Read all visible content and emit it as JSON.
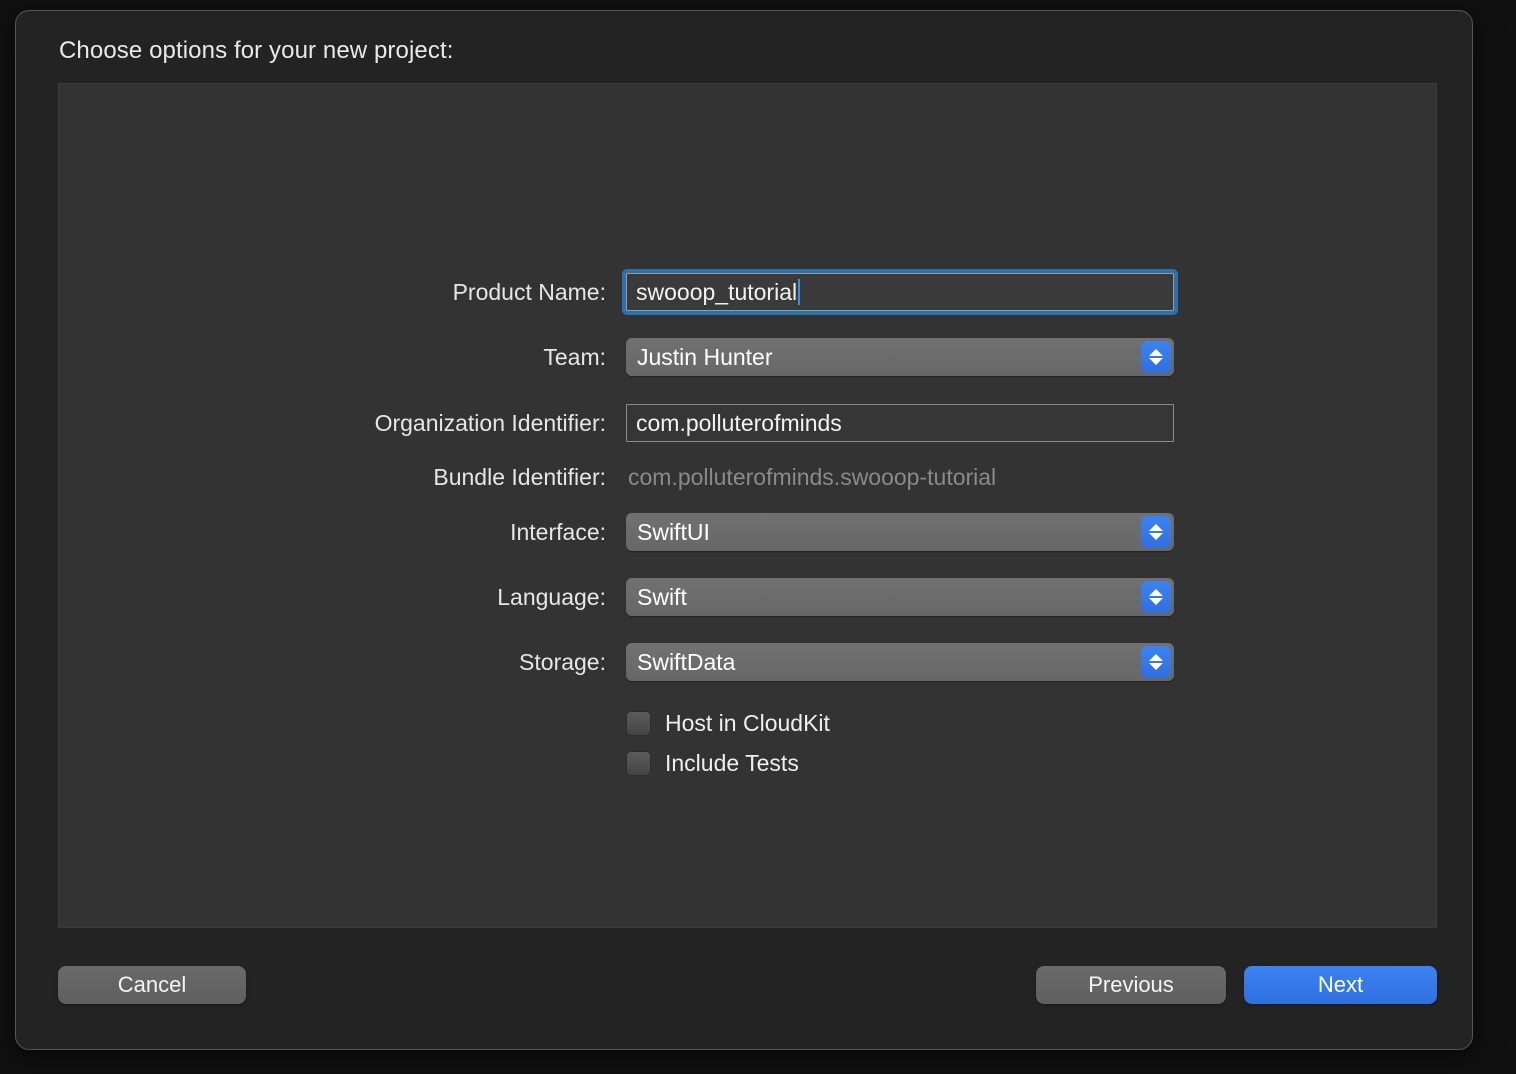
{
  "dialog": {
    "title": "Choose options for your new project:"
  },
  "form": {
    "rows": [
      {
        "label": "Product Name:",
        "type": "textfield",
        "value": "swooop_tutorial",
        "focused": true
      },
      {
        "label": "Team:",
        "type": "popup",
        "value": "Justin Hunter"
      },
      {
        "label": "Organization Identifier:",
        "type": "textfield",
        "value": "com.polluterofminds",
        "focused": false
      },
      {
        "label": "Bundle Identifier:",
        "type": "static",
        "value": "com.polluterofminds.swooop-tutorial"
      },
      {
        "label": "Interface:",
        "type": "popup",
        "value": "SwiftUI"
      },
      {
        "label": "Language:",
        "type": "popup",
        "value": "Swift"
      },
      {
        "label": "Storage:",
        "type": "popup",
        "value": "SwiftData"
      }
    ],
    "checkboxes": [
      {
        "label": "Host in CloudKit",
        "checked": false
      },
      {
        "label": "Include Tests",
        "checked": false
      }
    ]
  },
  "footer": {
    "cancel_label": "Cancel",
    "previous_label": "Previous",
    "next_label": "Next"
  },
  "colors": {
    "accent_blue": "#3d83f2",
    "focus_ring": "#2b72ad",
    "dialog_bg": "#232323",
    "panel_bg": "#333333",
    "popup_gray": "#6b6b6b",
    "disabled_text": "#8a8a8a"
  }
}
